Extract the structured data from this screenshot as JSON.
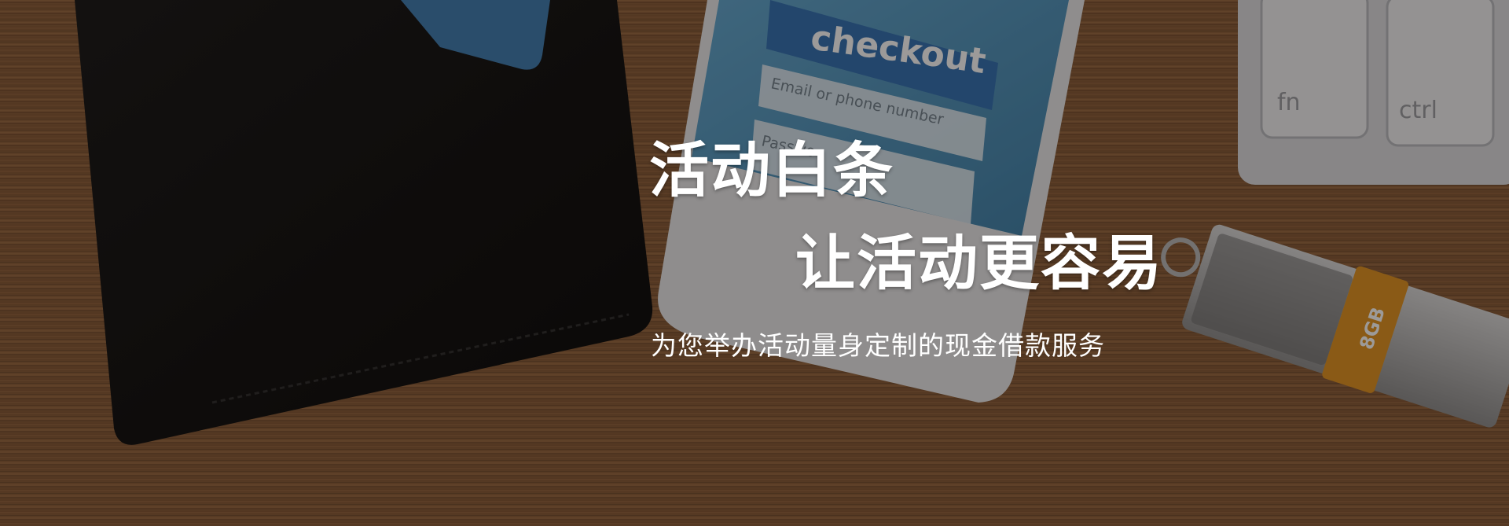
{
  "banner": {
    "headline_1": "活动白条",
    "headline_2": "让活动更容易",
    "subtitle": "为您举办活动量身定制的现金借款服务"
  },
  "photo": {
    "phone_screen_title": "checkout",
    "phone_field_email": "Email or phone number",
    "phone_field_password": "Passwo",
    "key_1": "fn",
    "key_2": "ctrl",
    "usb_capacity": "8GB"
  },
  "colors": {
    "text": "#ffffff",
    "wood": "#8a5a34",
    "usb_band": "#e0921e",
    "phone_screen": "#4a8fb8"
  }
}
